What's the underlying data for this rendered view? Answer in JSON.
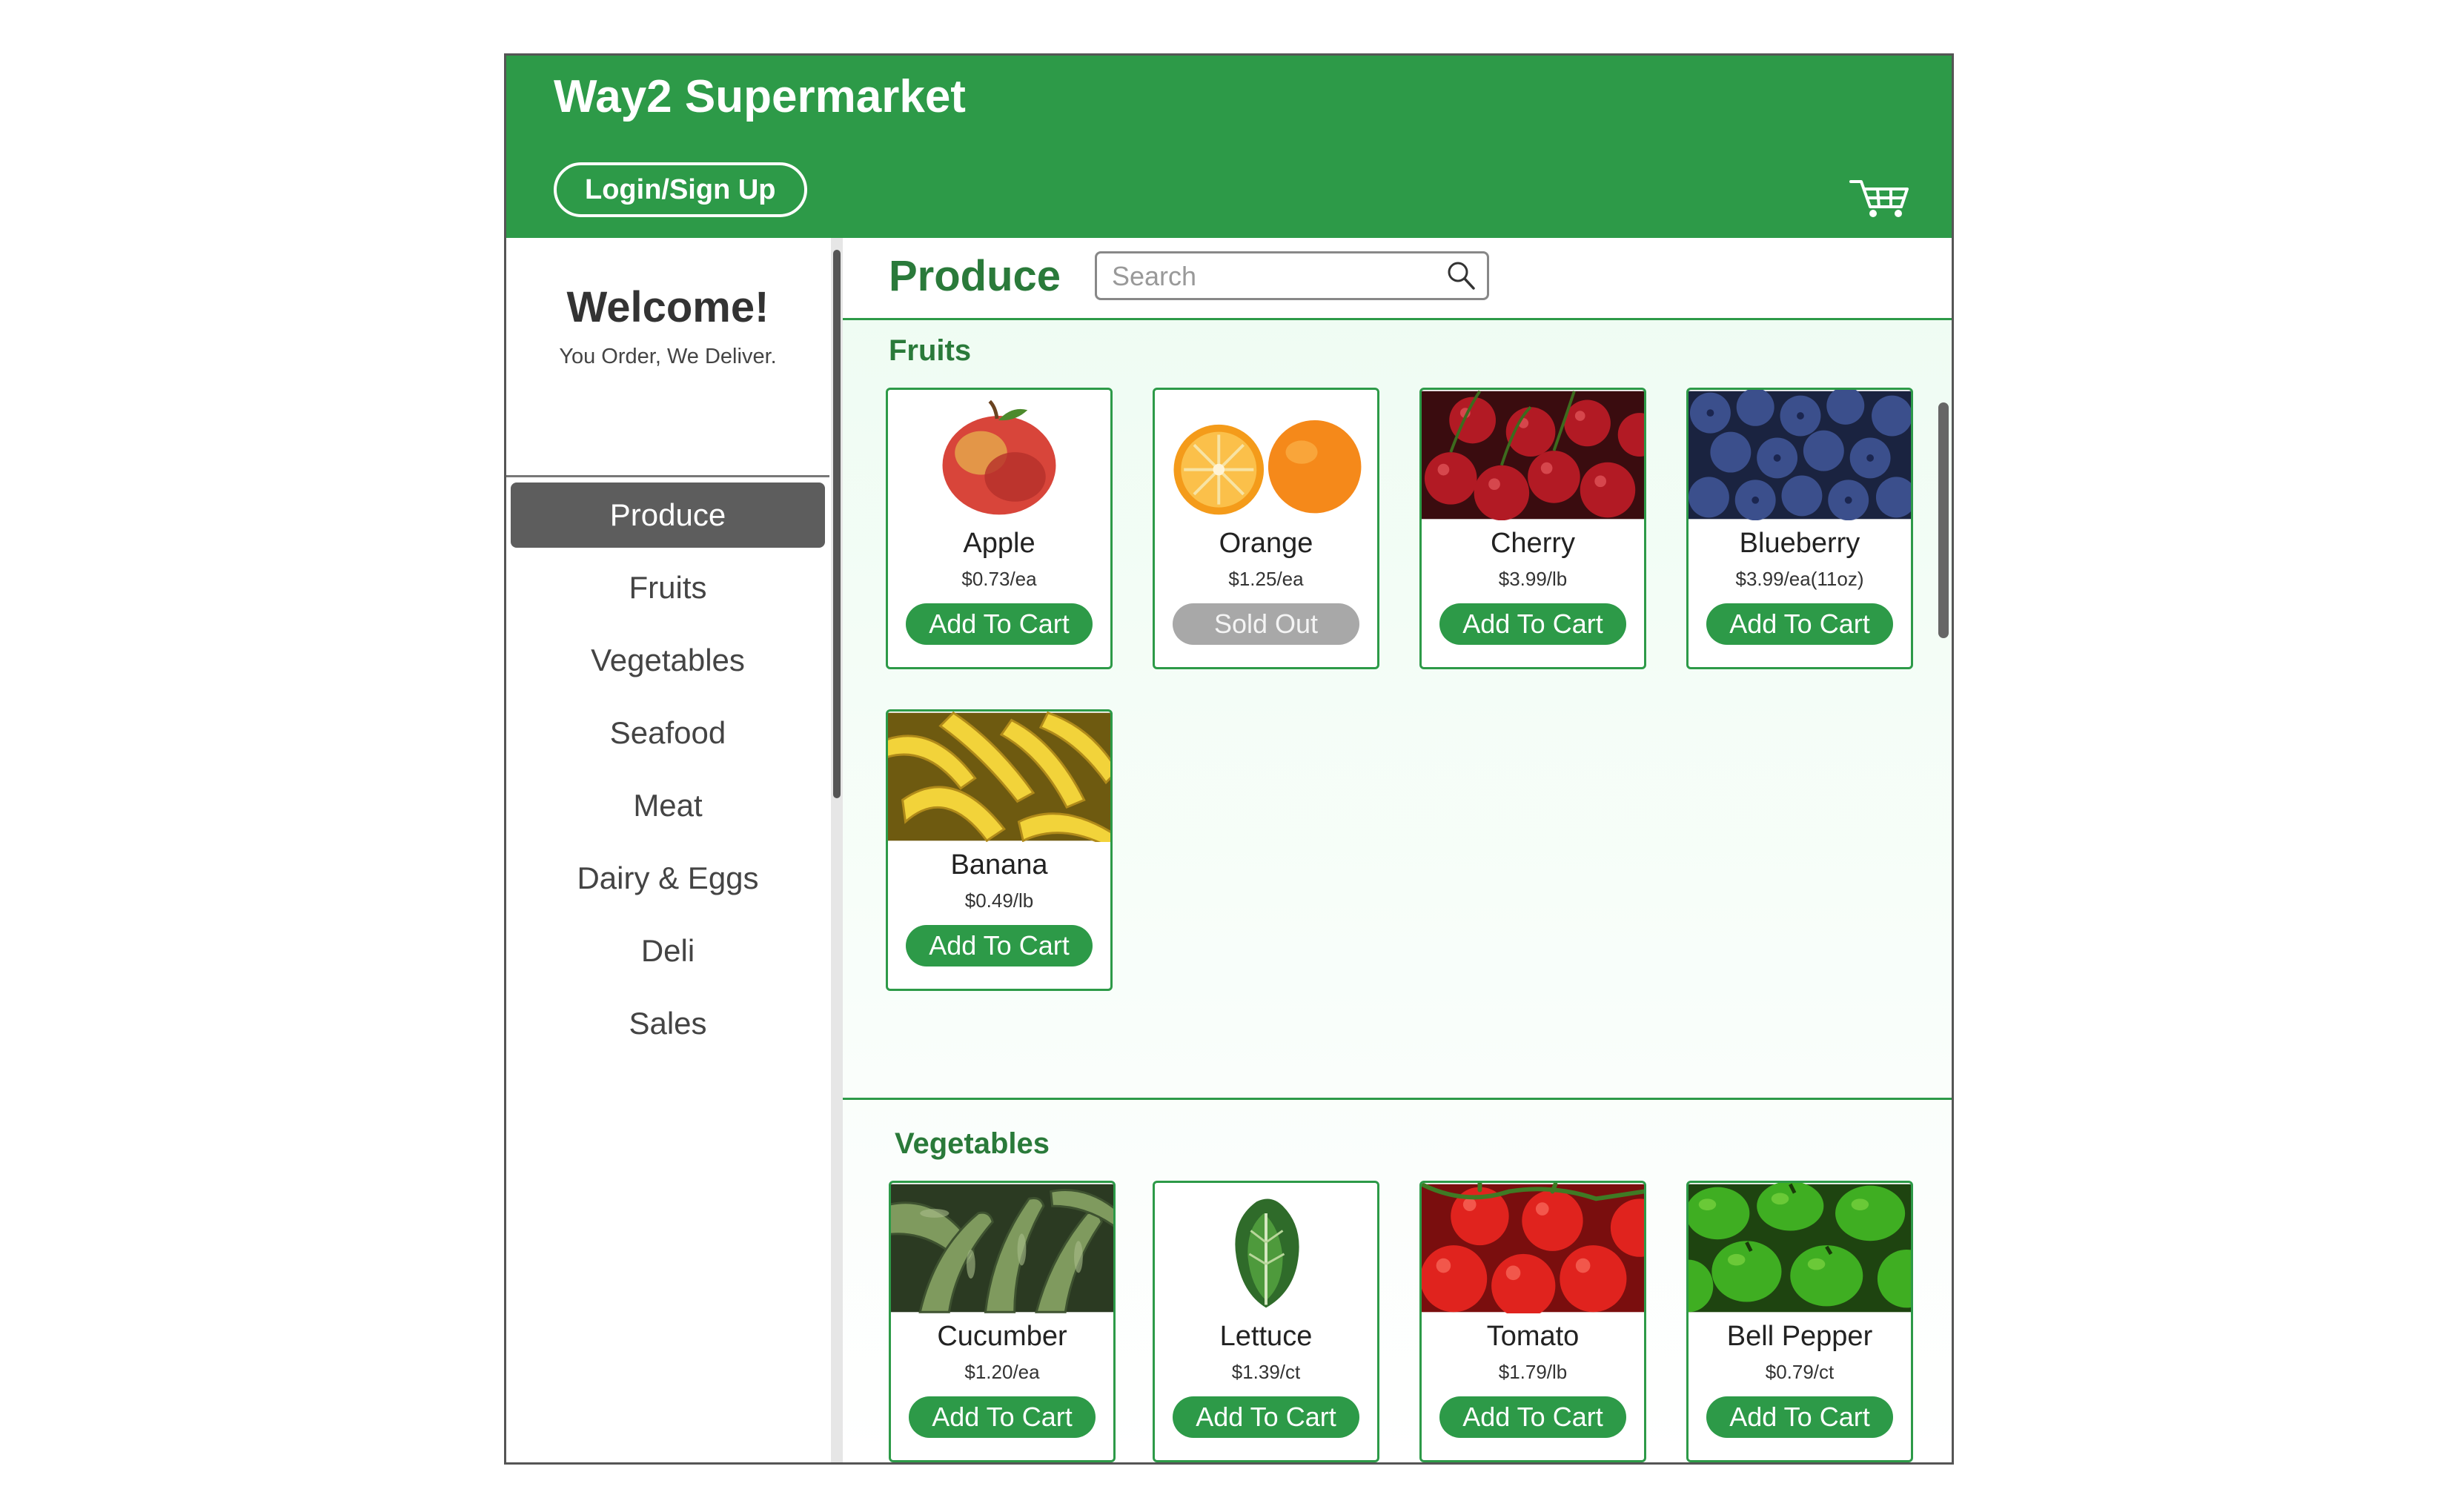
{
  "header": {
    "brand": "Way2 Supermarket",
    "login_label": "Login/Sign Up",
    "cart_icon": "cart-icon"
  },
  "sidebar": {
    "welcome": "Welcome!",
    "tagline": "You Order, We Deliver.",
    "items": [
      {
        "label": "Produce",
        "active": true
      },
      {
        "label": "Fruits"
      },
      {
        "label": "Vegetables"
      },
      {
        "label": "Seafood"
      },
      {
        "label": "Meat"
      },
      {
        "label": "Dairy & Eggs"
      },
      {
        "label": "Deli"
      },
      {
        "label": "Sales"
      }
    ]
  },
  "main": {
    "title": "Produce",
    "search": {
      "placeholder": "Search",
      "value": ""
    },
    "sections": [
      {
        "title": "Fruits",
        "products": [
          {
            "name": "Apple",
            "price": "$0.73/ea",
            "button": "Add To Cart",
            "image": "apple"
          },
          {
            "name": "Orange",
            "price": "$1.25/ea",
            "button": "Sold Out",
            "image": "orange"
          },
          {
            "name": "Cherry",
            "price": "$3.99/lb",
            "button": "Add To Cart",
            "image": "cherry"
          },
          {
            "name": "Blueberry",
            "price": "$3.99/ea(11oz)",
            "button": "Add To Cart",
            "image": "blueberry"
          },
          {
            "name": "Banana",
            "price": "$0.49/lb",
            "button": "Add To Cart",
            "image": "banana"
          }
        ]
      },
      {
        "title": "Vegetables",
        "products": [
          {
            "name": "Cucumber",
            "price": "$1.20/ea",
            "button": "Add To Cart",
            "image": "cucumber"
          },
          {
            "name": "Lettuce",
            "price": "$1.39/ct",
            "button": "Add To Cart",
            "image": "lettuce"
          },
          {
            "name": "Tomato",
            "price": "$1.79/lb",
            "button": "Add To Cart",
            "image": "tomato"
          },
          {
            "name": "Bell Pepper",
            "price": "$0.79/ct",
            "button": "Add To Cart",
            "image": "bell-pepper"
          }
        ]
      }
    ]
  },
  "colors": {
    "brand_green": "#2d9a48",
    "sold_out_gray": "#a8a8a8",
    "nav_active": "#5d5d5d"
  }
}
